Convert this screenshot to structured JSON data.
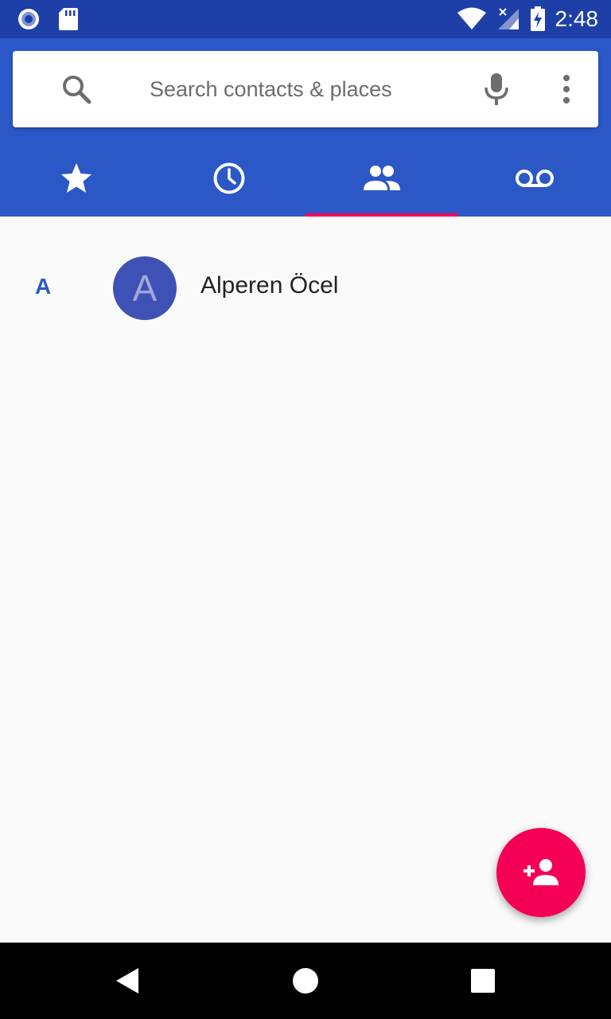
{
  "status_bar": {
    "time": "2:48",
    "icons": [
      "cast-record-icon",
      "sd-card-icon",
      "wifi-icon",
      "signal-no-sim-icon",
      "battery-charging-icon"
    ]
  },
  "search": {
    "placeholder": "Search contacts & places"
  },
  "tabs": [
    {
      "name": "speed-dial",
      "icon": "star-icon",
      "active": false
    },
    {
      "name": "recents",
      "icon": "clock-icon",
      "active": false
    },
    {
      "name": "contacts",
      "icon": "people-icon",
      "active": true
    },
    {
      "name": "voicemail",
      "icon": "voicemail-icon",
      "active": false
    }
  ],
  "contacts": {
    "section_letter": "A",
    "items": [
      {
        "initial": "A",
        "name": "Alperen Öcel"
      }
    ]
  },
  "fab": {
    "icon": "add-person-icon"
  },
  "colors": {
    "header": "#2b58c6",
    "status_bar": "#1e3fa8",
    "accent": "#f50057",
    "avatar": "#3f51b5"
  }
}
